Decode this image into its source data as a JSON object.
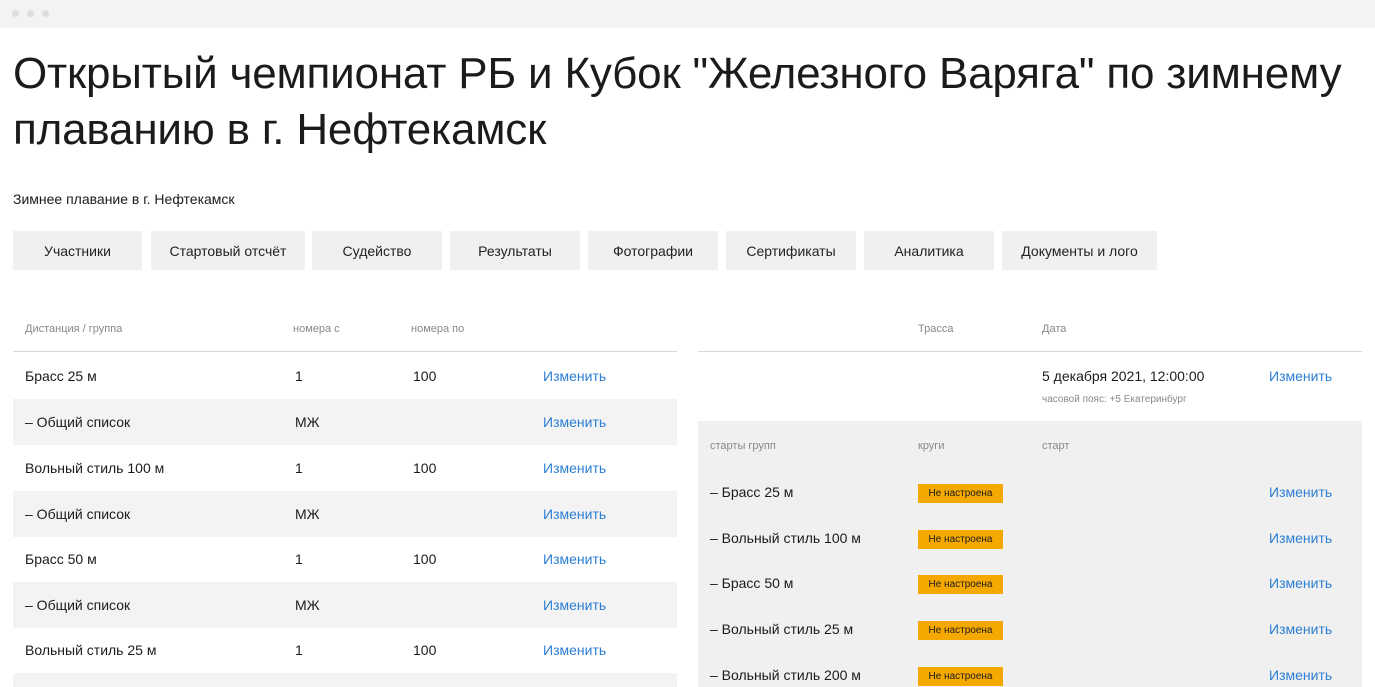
{
  "page": {
    "title": "Открытый чемпионат РБ и Кубок \"Железного Варяга\" по зимнему плаванию в г. Нефтекамск",
    "subtitle": "Зимнее плавание в г. Нефтекамск"
  },
  "tabs": [
    "Участники",
    "Стартовый отсчёт",
    "Судейство",
    "Результаты",
    "Фотографии",
    "Сертификаты",
    "Аналитика",
    "Документы и лого"
  ],
  "left_table": {
    "headers": {
      "distance": "Дистанция / группа",
      "from": "номера с",
      "to": "номера по"
    },
    "rows": [
      {
        "name": "Брасс 25 м",
        "from": "1",
        "to": "100",
        "action": "Изменить"
      },
      {
        "name": "– Общий список",
        "from": "МЖ",
        "to": "",
        "action": "Изменить"
      },
      {
        "name": "Вольный стиль 100 м",
        "from": "1",
        "to": "100",
        "action": "Изменить"
      },
      {
        "name": "– Общий список",
        "from": "МЖ",
        "to": "",
        "action": "Изменить"
      },
      {
        "name": "Брасс 50 м",
        "from": "1",
        "to": "100",
        "action": "Изменить"
      },
      {
        "name": "– Общий список",
        "from": "МЖ",
        "to": "",
        "action": "Изменить"
      },
      {
        "name": "Вольный стиль 25 м",
        "from": "1",
        "to": "100",
        "action": "Изменить"
      }
    ]
  },
  "right_table": {
    "headers": {
      "track": "Трасса",
      "date": "Дата"
    },
    "date": "5 декабря 2021, 12:00:00",
    "timezone": "часовой пояс: +5 Екатеринбург",
    "date_action": "Изменить",
    "group_headers": {
      "group": "старты групп",
      "laps": "круги",
      "start": "старт"
    },
    "groups": [
      {
        "name": "– Брасс 25 м",
        "status": "Не настроена",
        "action": "Изменить"
      },
      {
        "name": "– Вольный стиль 100 м",
        "status": "Не настроена",
        "action": "Изменить"
      },
      {
        "name": "– Брасс 50 м",
        "status": "Не настроена",
        "action": "Изменить"
      },
      {
        "name": "– Вольный стиль 25 м",
        "status": "Не настроена",
        "action": "Изменить"
      },
      {
        "name": "– Вольный стиль 200 м",
        "status": "Не настроена",
        "action": "Изменить"
      }
    ]
  },
  "colors": {
    "link": "#2b7fd4",
    "badge": "#f5a800",
    "row_alt": "#f3f3f3",
    "tab_bg": "#f0f0f0"
  }
}
